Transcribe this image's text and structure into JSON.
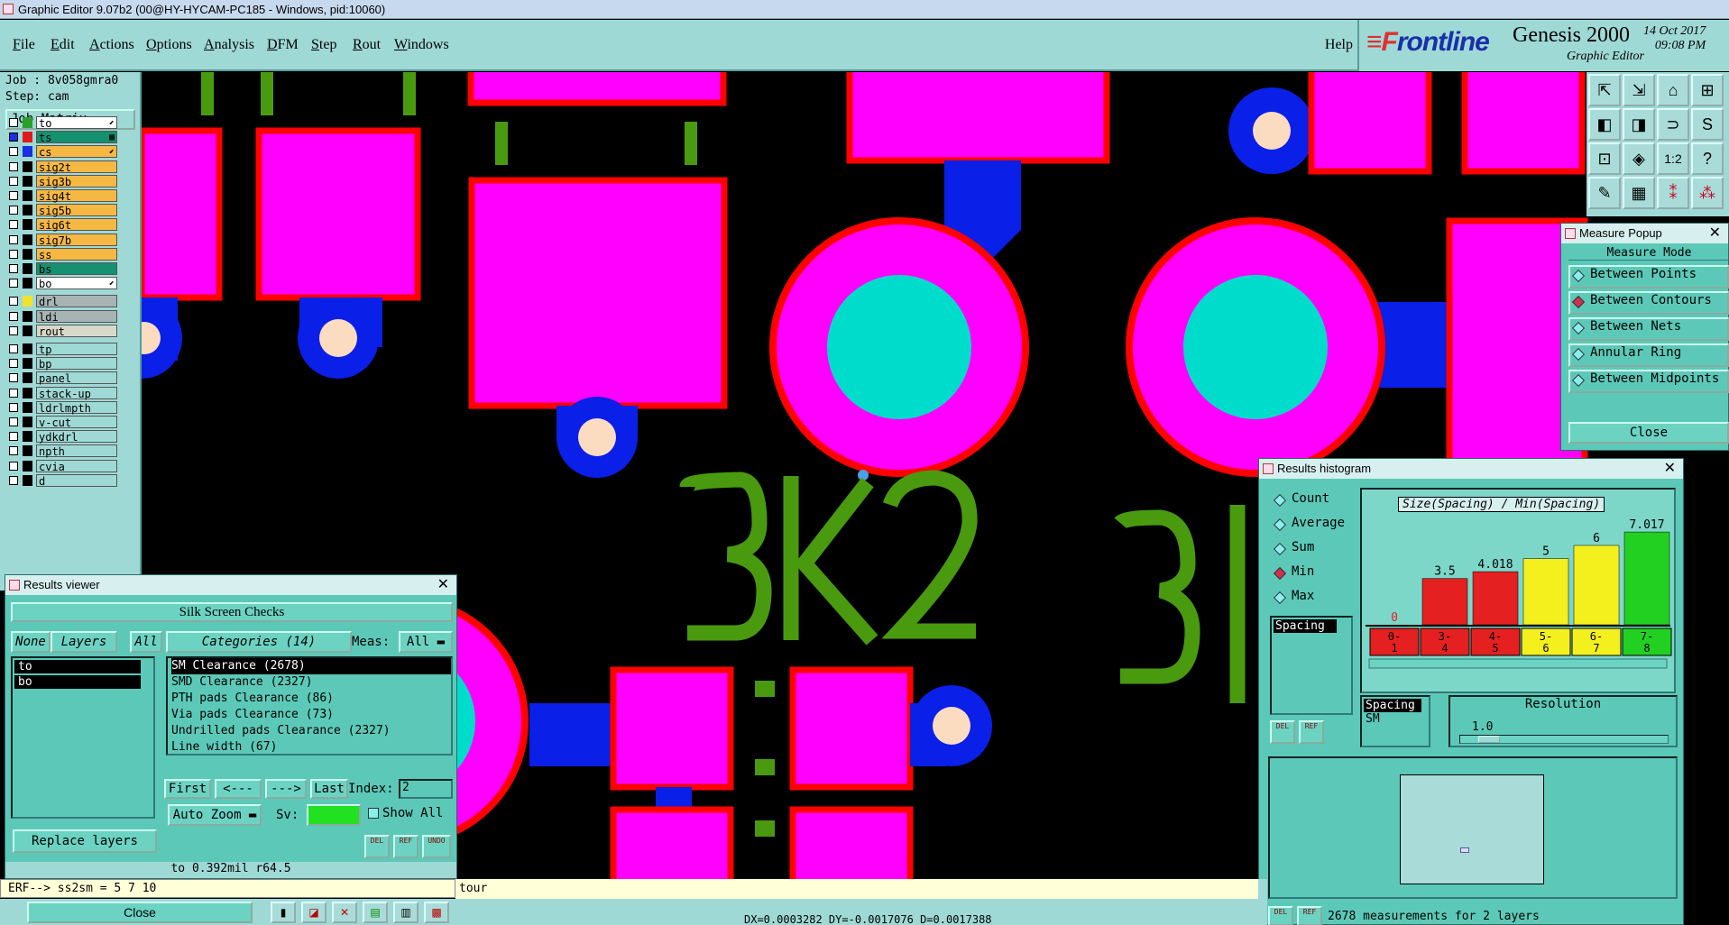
{
  "window": {
    "title": "Graphic Editor 9.07b2 (00@HY-HYCAM-PC185 - Windows, pid:10060)"
  },
  "menu": {
    "items": [
      "File",
      "Edit",
      "Actions",
      "Options",
      "Analysis",
      "DFM",
      "Step",
      "Rout",
      "Windows"
    ],
    "help": "Help"
  },
  "brand": {
    "logo_a": "≡F",
    "logo_b": "rontline",
    "product": "Genesis 2000",
    "subtitle": "Graphic Editor",
    "date": "14 Oct 2017",
    "time": "09:08 PM"
  },
  "job": {
    "job": "Job : 8v058gmra0",
    "step": "Step: cam",
    "matrix_button": "Job Matrix ..."
  },
  "layers": [
    {
      "name": "to",
      "color": "#ffffff",
      "swatch": "#2aa02a",
      "bg": "#ffffff",
      "mark": "⬋"
    },
    {
      "name": "ts",
      "color": "#ffffff",
      "swatch": "#e21a1a",
      "bg": "#159070",
      "mark": "▩"
    },
    {
      "name": "cs",
      "color": "#ffffff",
      "swatch": "#1a2fe0",
      "bg": "#f5b843",
      "mark": "⬋"
    },
    {
      "name": "sig2t",
      "swatch": "#000",
      "bg": "#f5b843"
    },
    {
      "name": "sig3b",
      "swatch": "#000",
      "bg": "#f5b843"
    },
    {
      "name": "sig4t",
      "swatch": "#000",
      "bg": "#f5b843"
    },
    {
      "name": "sig5b",
      "swatch": "#000",
      "bg": "#f5b843"
    },
    {
      "name": "sig6t",
      "swatch": "#000",
      "bg": "#f5b843"
    },
    {
      "name": "sig7b",
      "swatch": "#000",
      "bg": "#f5b843"
    },
    {
      "name": "ss",
      "swatch": "#000",
      "bg": "#f5b843"
    },
    {
      "name": "bs",
      "swatch": "#000",
      "bg": "#159070"
    },
    {
      "name": "bo",
      "swatch": "#000",
      "bg": "#ffffff",
      "mark": "⬋"
    },
    {
      "name": "drl",
      "swatch": "#f2e22a",
      "bg": "#a8b4b4"
    },
    {
      "name": "ldi",
      "swatch": "#000",
      "bg": "#a8b4b4"
    },
    {
      "name": "rout",
      "swatch": "#000",
      "bg": "#d8d8c8"
    },
    {
      "name": "tp",
      "swatch": "#000",
      "bg": "#9fd9d6"
    },
    {
      "name": "bp",
      "swatch": "#000",
      "bg": "#9fd9d6"
    },
    {
      "name": "panel",
      "swatch": "#000",
      "bg": "#9fd9d6"
    },
    {
      "name": "stack-up",
      "swatch": "#000",
      "bg": "#9fd9d6"
    },
    {
      "name": "ldrlmpth",
      "swatch": "#000",
      "bg": "#9fd9d6"
    },
    {
      "name": "v-cut",
      "swatch": "#000",
      "bg": "#9fd9d6"
    },
    {
      "name": "ydkdrl",
      "swatch": "#000",
      "bg": "#9fd9d6"
    },
    {
      "name": "npth",
      "swatch": "#000",
      "bg": "#9fd9d6"
    },
    {
      "name": "cvia",
      "swatch": "#000",
      "bg": "#9fd9d6"
    },
    {
      "name": "d",
      "swatch": "#000",
      "bg": "#9fd9d6"
    }
  ],
  "canvas": {
    "silk_text": "3K2",
    "silk_text2": "3I"
  },
  "measure": {
    "title": "Measure Popup",
    "header": "Measure Mode",
    "modes": [
      "Between Points",
      "Between Contours",
      "Between Nets",
      "Annular Ring",
      "Between Midpoints"
    ],
    "selected": 1,
    "close": "Close"
  },
  "results_viewer": {
    "title": "Results viewer",
    "heading": "Silk Screen Checks",
    "none": "None",
    "layers": "Layers",
    "all": "All",
    "categories_label": "Categories (14)",
    "meas_label": "Meas:",
    "meas_value": "All",
    "layer_list": [
      "to",
      "bo"
    ],
    "categories": [
      "SM Clearance (2678)",
      "SMD Clearance (2327)",
      "PTH pads Clearance (86)",
      "Via pads Clearance (73)",
      "Undrilled pads Clearance (2327)",
      "Line width (67)"
    ],
    "first": "First",
    "prev": "<---",
    "next": "--->",
    "last": "Last",
    "index_label": "Index:",
    "index_value": "2",
    "auto_zoom": "Auto Zoom",
    "sv_label": "Sv:",
    "show_all": "Show All",
    "replace_layers": "Replace layers",
    "del": "DEL",
    "ref": "REF",
    "undo": "UNDO",
    "status": "to 0.392mil  r64.5"
  },
  "histogram": {
    "title": "Results histogram",
    "modes": [
      "Count",
      "Average",
      "Sum",
      "Min",
      "Max"
    ],
    "selected": 3,
    "list_item": "Spacing",
    "chart_title": "Size(Spacing) / Min(Spacing)",
    "spacing_label": "Spacing",
    "sm_label": "SM",
    "resolution_label": "Resolution",
    "resolution_value": "1.0",
    "del": "DEL",
    "ref": "REF",
    "footer": "2678 measurements for 2 layers"
  },
  "chart_data": {
    "type": "bar",
    "categories": [
      "0-1",
      "3-4",
      "4-5",
      "5-6",
      "6-7",
      "7-8"
    ],
    "values": [
      0,
      3.5,
      4.018,
      5,
      6,
      7.017
    ],
    "value_labels": [
      "0",
      "3.5",
      "4.018",
      "5",
      "6",
      "7.017"
    ],
    "colors": [
      "#e42020",
      "#e42020",
      "#e42020",
      "#f3f01e",
      "#f3f01e",
      "#22d022"
    ],
    "title": "Size(Spacing) / Min(Spacing)",
    "ylim": [
      0,
      7.5
    ]
  },
  "cmdline": "ERF--> ss2sm = 5 7 10",
  "close_label": "Close",
  "statusbar": {
    "left": "tour",
    "coords": "DX=0.0003282 DY=-0.0017076 D=0.0017388"
  }
}
